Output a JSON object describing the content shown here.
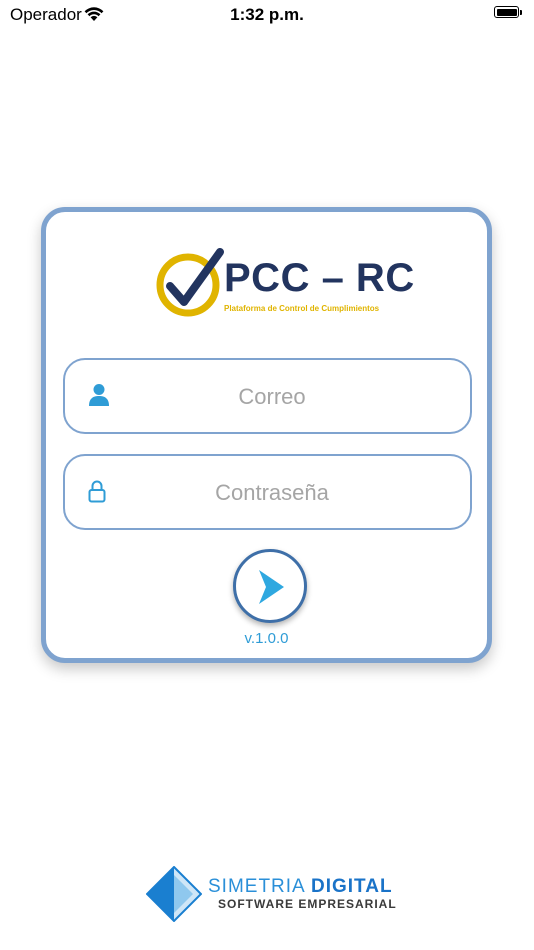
{
  "status_bar": {
    "carrier": "Operador",
    "time": "1:32 p.m."
  },
  "logo": {
    "title": "PCC – RC",
    "subtitle": "Plataforma de Control de Cumplimientos",
    "colors": {
      "navy": "#22345f",
      "gold": "#e0b400"
    }
  },
  "login": {
    "email_placeholder": "Correo",
    "email_value": "",
    "password_placeholder": "Contraseña",
    "password_value": "",
    "submit_icon": "arrow-right-icon",
    "version": "v.1.0.0"
  },
  "footer": {
    "brand_first": "SIMETRIA",
    "brand_second": "DIGITAL",
    "tagline": "SOFTWARE EMPRESARIAL"
  },
  "theme": {
    "accent": "#2f9cd6",
    "border": "#7fa3cf",
    "button_border": "#3e6fa8"
  }
}
